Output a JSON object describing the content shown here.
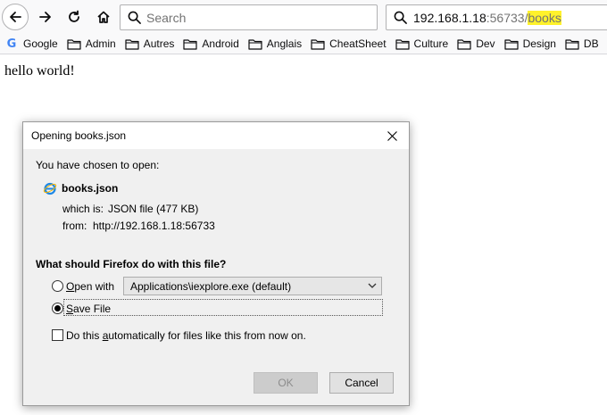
{
  "browser": {
    "search_placeholder": "Search",
    "url_host": "192.168.1.18",
    "url_port": ":56733/",
    "url_path": "books",
    "highlight_color": "#fff22b"
  },
  "bookmarks": [
    {
      "label": "Google",
      "icon": "google-icon"
    },
    {
      "label": "Admin",
      "icon": "folder-icon"
    },
    {
      "label": "Autres",
      "icon": "folder-icon"
    },
    {
      "label": "Android",
      "icon": "folder-icon"
    },
    {
      "label": "Anglais",
      "icon": "folder-icon"
    },
    {
      "label": "CheatSheet",
      "icon": "folder-icon"
    },
    {
      "label": "Culture",
      "icon": "folder-icon"
    },
    {
      "label": "Dev",
      "icon": "folder-icon"
    },
    {
      "label": "Design",
      "icon": "folder-icon"
    },
    {
      "label": "DB",
      "icon": "folder-icon"
    }
  ],
  "page": {
    "text": "hello world!"
  },
  "dialog": {
    "title": "Opening books.json",
    "intro": "You have chosen to open:",
    "file_name": "books.json",
    "which_is_label": "which is:",
    "which_is_value": "JSON file (477 KB)",
    "from_label": "from:",
    "from_value": "http://192.168.1.18:56733",
    "question": "What should Firefox do with this file?",
    "open_with_label_access": "O",
    "open_with_label_rest": "pen with",
    "open_with_app": "Applications\\iexplore.exe (default)",
    "save_label_access": "S",
    "save_label_rest": "ave File",
    "auto_label_pre": "Do this ",
    "auto_label_access": "a",
    "auto_label_post": "utomatically for files like this from now on.",
    "ok_label": "OK",
    "cancel_label": "Cancel",
    "selected_option": "save-file",
    "auto_checked": false
  }
}
